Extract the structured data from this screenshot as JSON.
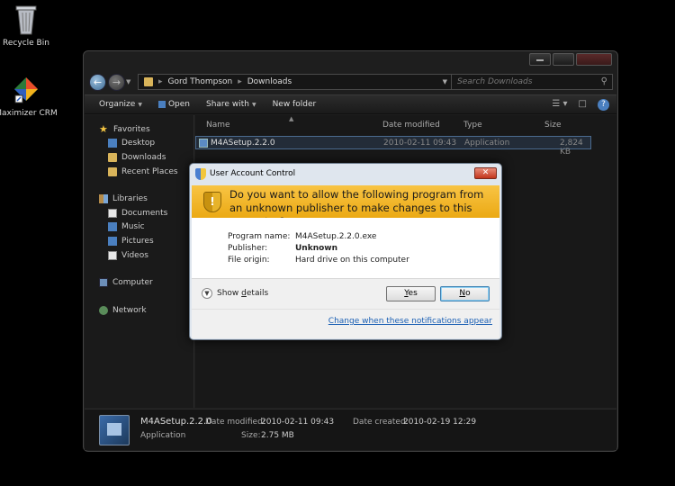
{
  "desktop": {
    "icons": [
      {
        "label": "Recycle Bin"
      },
      {
        "label": "Maximizer CRM"
      }
    ]
  },
  "explorer": {
    "breadcrumb": [
      "Gord Thompson",
      "Downloads"
    ],
    "search_placeholder": "Search Downloads",
    "toolbar": {
      "organize": "Organize",
      "open": "Open",
      "share_with": "Share with",
      "new_folder": "New folder"
    },
    "nav": {
      "favorites": "Favorites",
      "desktop": "Desktop",
      "downloads": "Downloads",
      "recent_places": "Recent Places",
      "libraries": "Libraries",
      "documents": "Documents",
      "music": "Music",
      "pictures": "Pictures",
      "videos": "Videos",
      "computer": "Computer",
      "network": "Network"
    },
    "columns": {
      "name": "Name",
      "date_modified": "Date modified",
      "type": "Type",
      "size": "Size"
    },
    "files": [
      {
        "name": "M4ASetup.2.2.0",
        "date_modified": "2010-02-11 09:43",
        "type": "Application",
        "size": "2,824 KB"
      }
    ],
    "details_pane": {
      "name": "M4ASetup.2.2.0",
      "type": "Application",
      "date_modified_label": "Date modified:",
      "date_modified": "2010-02-11 09:43",
      "date_created_label": "Date created:",
      "date_created": "2010-02-19 12:29",
      "size_label": "Size:",
      "size": "2.75 MB"
    }
  },
  "uac": {
    "title": "User Account Control",
    "question": "Do you want to allow the following program from an unknown publisher to make changes to this computer?",
    "program_name_label": "Program name:",
    "program_name": "M4ASetup.2.2.0.exe",
    "publisher_label": "Publisher:",
    "publisher": "Unknown",
    "file_origin_label": "File origin:",
    "file_origin": "Hard drive on this computer",
    "show_details_pre": "Show ",
    "show_details_key": "d",
    "show_details_post": "etails",
    "yes_key": "Y",
    "yes_rest": "es",
    "no_key": "N",
    "no_rest": "o",
    "notifications_link": "Change when these notifications appear"
  }
}
